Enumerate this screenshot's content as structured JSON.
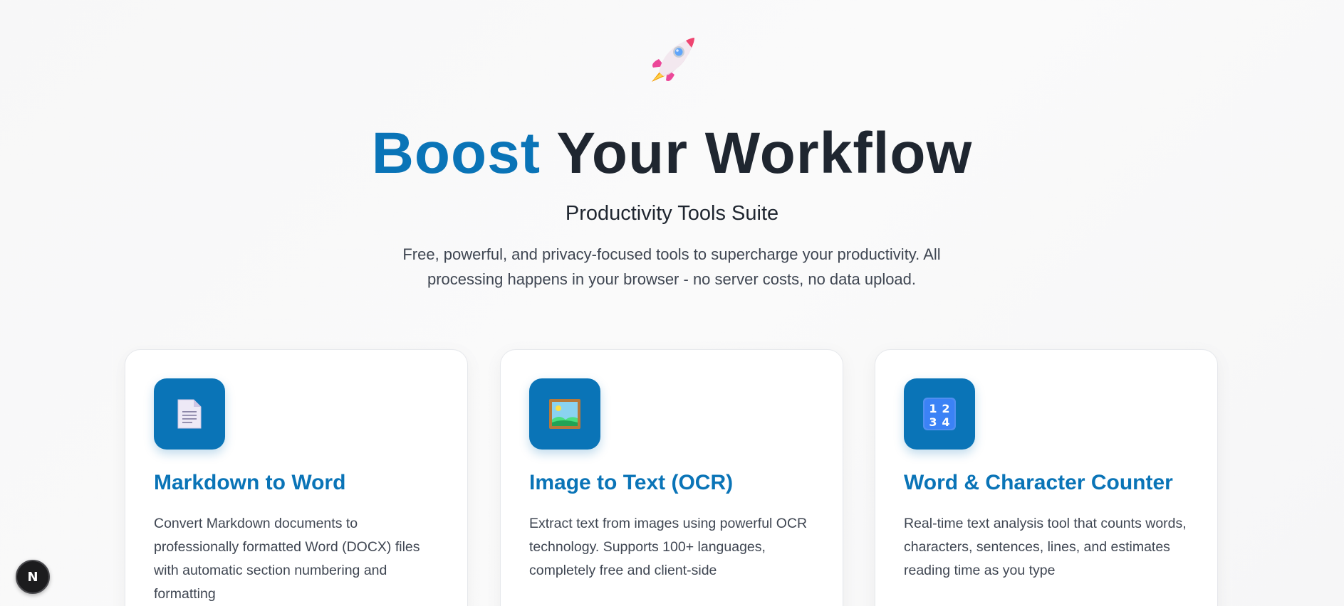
{
  "hero": {
    "icon": "rocket-icon",
    "headline_accent": "Boost",
    "headline_rest": " Your Workflow",
    "subtitle": "Productivity Tools Suite",
    "description": "Free, powerful, and privacy-focused tools to supercharge your productivity. All processing happens in your browser - no server costs, no data upload."
  },
  "tools": [
    {
      "icon": "document-icon",
      "title": "Markdown to Word",
      "description": "Convert Markdown documents to professionally formatted Word (DOCX) files with automatic section numbering and formatting"
    },
    {
      "icon": "framed-picture-icon",
      "title": "Image to Text (OCR)",
      "description": "Extract text from images using powerful OCR technology. Supports 100+ languages, completely free and client-side"
    },
    {
      "icon": "number-keypad-icon",
      "title": "Word & Character Counter",
      "description": "Real-time text analysis tool that counts words, characters, sentences, lines, and estimates reading time as you type"
    }
  ],
  "floating_button": {
    "label": "N",
    "icon": "nextjs-logo-icon"
  },
  "colors": {
    "accent": "#0a74b7",
    "heading": "#1f2630",
    "text": "#3f4652"
  }
}
